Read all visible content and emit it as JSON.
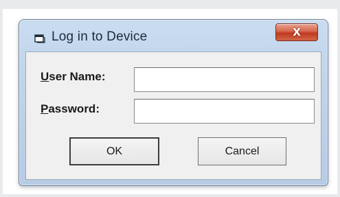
{
  "dialog": {
    "title": "Log in to Device",
    "title_icon": "dialog-window-icon",
    "close_glyph": "X"
  },
  "form": {
    "user_name": {
      "mnemonic": "U",
      "label_rest": "ser Name:",
      "value": "",
      "placeholder": ""
    },
    "password": {
      "mnemonic": "P",
      "label_rest": "assword:",
      "value": "",
      "placeholder": ""
    }
  },
  "buttons": {
    "ok_label": "OK",
    "cancel_label": "Cancel"
  },
  "colors": {
    "frame": "#bfd3ea",
    "close_button": "#c0391f",
    "client": "#f0f0f0"
  }
}
